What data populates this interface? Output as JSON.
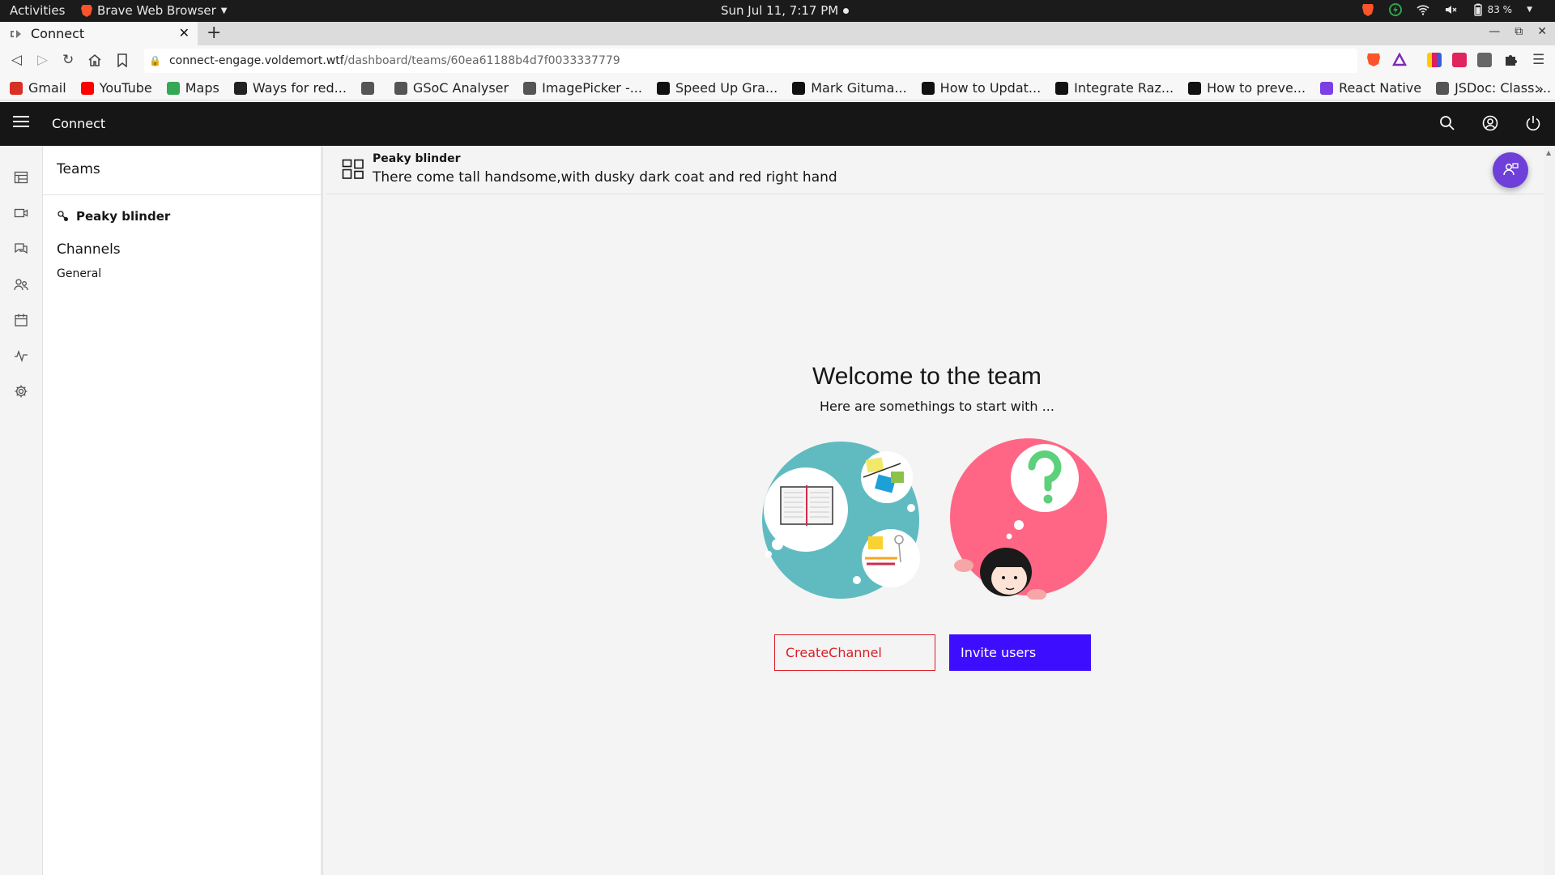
{
  "system": {
    "activities": "Activities",
    "app_name": "Brave Web Browser",
    "clock": "Sun Jul 11,  7:17 PM",
    "battery": "83 %"
  },
  "browser": {
    "tab_title": "Connect",
    "url_host": "connect-engage.voldemort.wtf",
    "url_path": "/dashboard/teams/60ea61188b4d7f0033337779",
    "bookmarks": [
      {
        "label": "Gmail",
        "icon": "gmail-icon",
        "color": "#d93025"
      },
      {
        "label": "YouTube",
        "icon": "youtube-icon",
        "color": "#ff0000"
      },
      {
        "label": "Maps",
        "icon": "maps-icon",
        "color": "#34a853"
      },
      {
        "label": "Ways for red...",
        "icon": "site-icon",
        "color": "#222222"
      },
      {
        "label": "",
        "icon": "globe-icon",
        "color": "#555555"
      },
      {
        "label": "GSoC Analyser",
        "icon": "chart-icon",
        "color": "#555555"
      },
      {
        "label": "ImagePicker -...",
        "icon": "site-icon",
        "color": "#555555"
      },
      {
        "label": "Speed Up Gra...",
        "icon": "medium-icon",
        "color": "#111111"
      },
      {
        "label": "Mark Gituma...",
        "icon": "medium-icon",
        "color": "#111111"
      },
      {
        "label": "How to Updat...",
        "icon": "dev-icon",
        "color": "#111111"
      },
      {
        "label": "Integrate Raz...",
        "icon": "dev-icon",
        "color": "#111111"
      },
      {
        "label": "How to preve...",
        "icon": "site-icon",
        "color": "#111111"
      },
      {
        "label": "React Native",
        "icon": "dots-icon",
        "color": "#7b3fe4"
      },
      {
        "label": "JSDoc: Class:...",
        "icon": "globe-icon",
        "color": "#555555"
      }
    ]
  },
  "app": {
    "brand": "Connect",
    "sidebar": {
      "title": "Teams",
      "team_name": "Peaky blinder",
      "channels_title": "Channels",
      "channels": [
        "General"
      ]
    },
    "header": {
      "team_name": "Peaky blinder",
      "description": "There come tall handsome,with dusky dark coat and red right hand"
    },
    "welcome": {
      "title": "Welcome to the team",
      "subtitle": "Here are somethings to start with ..."
    },
    "buttons": {
      "create_channel": "CreateChannel",
      "invite_users": "Invite users"
    },
    "colors": {
      "danger": "#da1e28",
      "primary": "#3d0dff",
      "fab": "#6e3fd9",
      "teal_illustration": "#60bbc1",
      "pink_illustration": "#ff6685"
    }
  }
}
